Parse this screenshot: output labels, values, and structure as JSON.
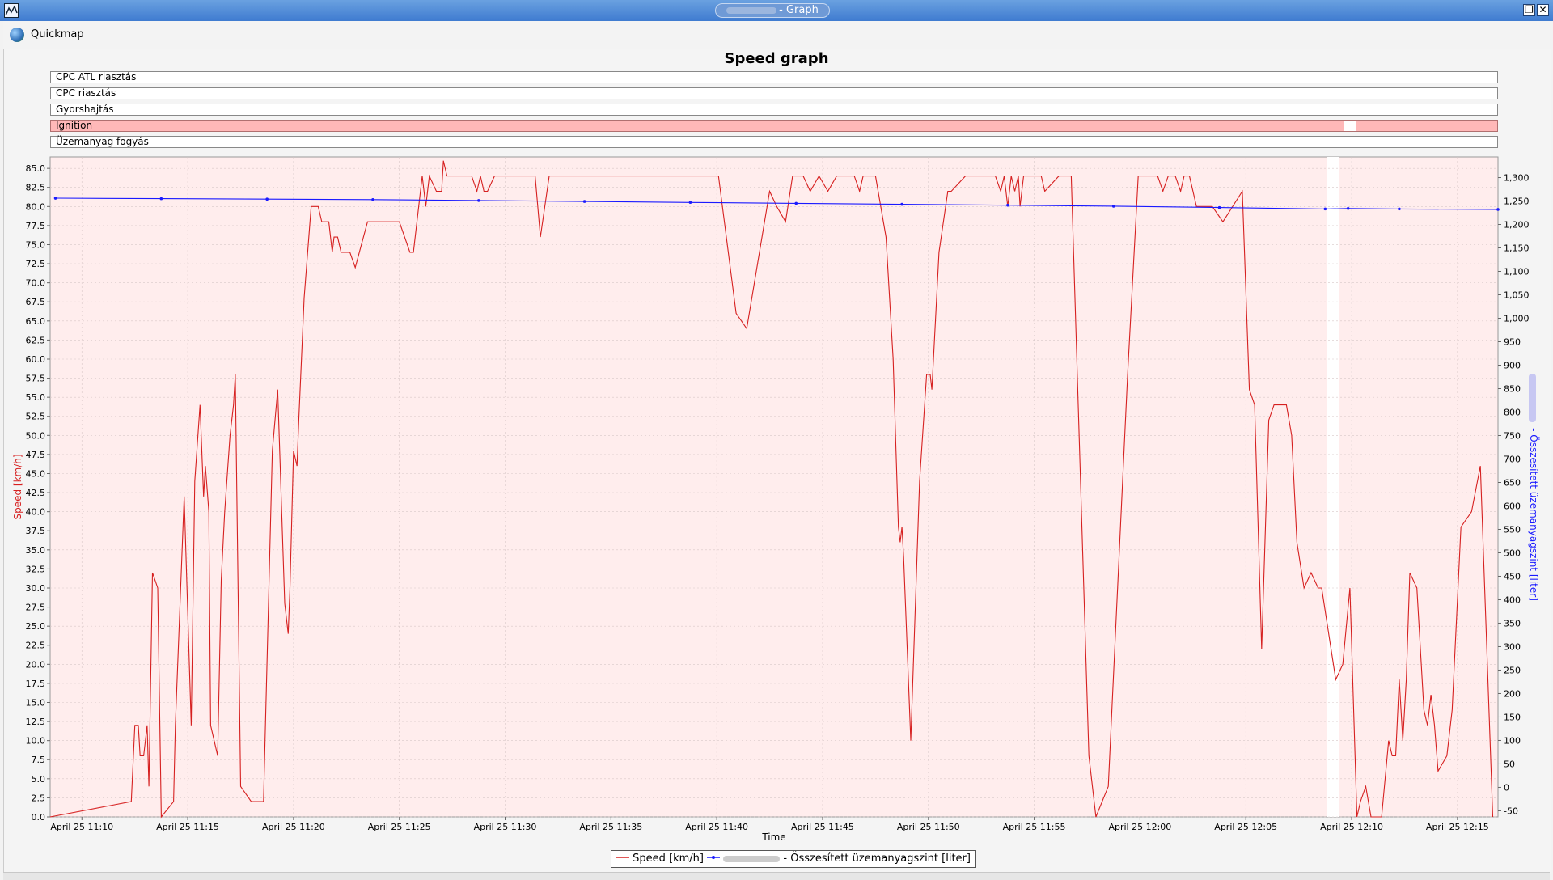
{
  "window": {
    "title": "- Graph"
  },
  "toolbar": {
    "quickmap_label": "Quickmap"
  },
  "chart_title": "Speed graph",
  "event_bands": [
    {
      "label": "CPC ATL riasztás",
      "active": false
    },
    {
      "label": "CPC riasztás",
      "active": false
    },
    {
      "label": "Gyorshajtás",
      "active": false
    },
    {
      "label": "Ignition",
      "active": true
    },
    {
      "label": "Üzemanyag fogyás",
      "active": false
    }
  ],
  "colors": {
    "speed": "#d62020",
    "fuel": "#1a1aff",
    "plot_bg": "#ffeded",
    "ignition_gap": "#ffffff"
  },
  "chart_data": {
    "type": "line",
    "title": "Speed graph",
    "xlabel": "Time",
    "x_ticks": [
      "April 25 11:10",
      "April 25 11:15",
      "April 25 11:20",
      "April 25 11:25",
      "April 25 11:30",
      "April 25 11:35",
      "April 25 11:40",
      "April 25 11:45",
      "April 25 11:50",
      "April 25 11:55",
      "April 25 12:00",
      "April 25 12:05",
      "April 25 12:10",
      "April 25 12:15"
    ],
    "x_start": "11:08:30",
    "x_end": "12:16:55",
    "y_left": {
      "label": "Speed [km/h]",
      "min": 0,
      "max": 86.5,
      "ticks": [
        "0.0",
        "2.5",
        "5.0",
        "7.5",
        "10.0",
        "12.5",
        "15.0",
        "17.5",
        "20.0",
        "22.5",
        "25.0",
        "27.5",
        "30.0",
        "32.5",
        "35.0",
        "37.5",
        "40.0",
        "42.5",
        "45.0",
        "47.5",
        "50.0",
        "52.5",
        "55.0",
        "57.5",
        "60.0",
        "62.5",
        "65.0",
        "67.5",
        "70.0",
        "72.5",
        "75.0",
        "77.5",
        "80.0",
        "82.5",
        "85.0"
      ]
    },
    "y_right": {
      "label": "- Összesített üzemanyagszint [liter]",
      "min": -63,
      "max": 1344,
      "ticks": [
        "-50",
        "0",
        "50",
        "100",
        "150",
        "200",
        "250",
        "300",
        "350",
        "400",
        "450",
        "500",
        "550",
        "600",
        "650",
        "700",
        "750",
        "800",
        "850",
        "900",
        "950",
        "1,000",
        "1,050",
        "1,100",
        "1,150",
        "1,200",
        "1,250",
        "1,300"
      ]
    },
    "ignition_off": {
      "start": "12:08:50",
      "end": "12:09:25"
    },
    "series": [
      {
        "name": "Speed [km/h]",
        "axis": "left",
        "points": [
          [
            "11:08:30",
            0
          ],
          [
            "11:12:20",
            2
          ],
          [
            "11:12:30",
            12
          ],
          [
            "11:12:40",
            12
          ],
          [
            "11:12:45",
            8
          ],
          [
            "11:12:55",
            8
          ],
          [
            "11:13:05",
            12
          ],
          [
            "11:13:10",
            4
          ],
          [
            "11:13:20",
            32
          ],
          [
            "11:13:35",
            30
          ],
          [
            "11:13:45",
            0
          ],
          [
            "11:14:20",
            2
          ],
          [
            "11:14:25",
            12
          ],
          [
            "11:14:50",
            42
          ],
          [
            "11:15:10",
            12
          ],
          [
            "11:15:20",
            44
          ],
          [
            "11:15:35",
            54
          ],
          [
            "11:15:45",
            42
          ],
          [
            "11:15:50",
            46
          ],
          [
            "11:16:00",
            40
          ],
          [
            "11:16:05",
            12
          ],
          [
            "11:16:25",
            8
          ],
          [
            "11:16:35",
            31
          ],
          [
            "11:16:45",
            40
          ],
          [
            "11:17:00",
            50
          ],
          [
            "11:17:10",
            54
          ],
          [
            "11:17:15",
            58
          ],
          [
            "11:17:30",
            4
          ],
          [
            "11:18:00",
            2
          ],
          [
            "11:18:35",
            2
          ],
          [
            "11:19:00",
            48
          ],
          [
            "11:19:15",
            56
          ],
          [
            "11:19:35",
            28
          ],
          [
            "11:19:45",
            24
          ],
          [
            "11:19:50",
            30
          ],
          [
            "11:20:00",
            48
          ],
          [
            "11:20:10",
            46
          ],
          [
            "11:20:15",
            52
          ],
          [
            "11:20:30",
            68
          ],
          [
            "11:20:50",
            80
          ],
          [
            "11:21:10",
            80
          ],
          [
            "11:21:20",
            78
          ],
          [
            "11:21:40",
            78
          ],
          [
            "11:21:50",
            74
          ],
          [
            "11:21:55",
            76
          ],
          [
            "11:22:05",
            76
          ],
          [
            "11:22:15",
            74
          ],
          [
            "11:22:40",
            74
          ],
          [
            "11:22:55",
            72
          ],
          [
            "11:23:30",
            78
          ],
          [
            "11:25:00",
            78
          ],
          [
            "11:25:30",
            74
          ],
          [
            "11:25:40",
            74
          ],
          [
            "11:26:05",
            84
          ],
          [
            "11:26:15",
            80
          ],
          [
            "11:26:25",
            84
          ],
          [
            "11:26:45",
            82
          ],
          [
            "11:27:00",
            82
          ],
          [
            "11:27:05",
            86
          ],
          [
            "11:27:15",
            84
          ],
          [
            "11:28:25",
            84
          ],
          [
            "11:28:40",
            82
          ],
          [
            "11:28:50",
            84
          ],
          [
            "11:29:00",
            82
          ],
          [
            "11:29:10",
            82
          ],
          [
            "11:29:30",
            84
          ],
          [
            "11:31:25",
            84
          ],
          [
            "11:31:40",
            76
          ],
          [
            "11:32:05",
            84
          ],
          [
            "11:36:30",
            84
          ],
          [
            "11:37:05",
            84
          ],
          [
            "11:40:05",
            84
          ],
          [
            "11:40:55",
            66
          ],
          [
            "11:41:25",
            64
          ],
          [
            "11:42:30",
            82
          ],
          [
            "11:42:50",
            80
          ],
          [
            "11:43:15",
            78
          ],
          [
            "11:43:35",
            84
          ],
          [
            "11:44:05",
            84
          ],
          [
            "11:44:25",
            82
          ],
          [
            "11:44:50",
            84
          ],
          [
            "11:45:15",
            82
          ],
          [
            "11:45:40",
            84
          ],
          [
            "11:46:30",
            84
          ],
          [
            "11:46:45",
            82
          ],
          [
            "11:46:55",
            84
          ],
          [
            "11:47:30",
            84
          ],
          [
            "11:48:00",
            76
          ],
          [
            "11:48:20",
            60
          ],
          [
            "11:48:35",
            38
          ],
          [
            "11:48:40",
            36
          ],
          [
            "11:48:45",
            38
          ],
          [
            "11:48:50",
            34
          ],
          [
            "11:49:10",
            10
          ],
          [
            "11:49:35",
            44
          ],
          [
            "11:49:55",
            58
          ],
          [
            "11:50:05",
            58
          ],
          [
            "11:50:10",
            56
          ],
          [
            "11:50:30",
            74
          ],
          [
            "11:50:55",
            82
          ],
          [
            "11:51:05",
            82
          ],
          [
            "11:51:45",
            84
          ],
          [
            "11:53:10",
            84
          ],
          [
            "11:53:25",
            82
          ],
          [
            "11:53:35",
            84
          ],
          [
            "11:53:45",
            80
          ],
          [
            "11:53:55",
            84
          ],
          [
            "11:54:05",
            82
          ],
          [
            "11:54:15",
            84
          ],
          [
            "11:54:20",
            80
          ],
          [
            "11:54:30",
            84
          ],
          [
            "11:55:20",
            84
          ],
          [
            "11:55:30",
            82
          ],
          [
            "11:56:10",
            84
          ],
          [
            "11:56:35",
            84
          ],
          [
            "11:56:45",
            84
          ],
          [
            "11:57:35",
            8
          ],
          [
            "11:57:55",
            0
          ],
          [
            "11:58:30",
            4
          ],
          [
            "11:59:25",
            58
          ],
          [
            "11:59:55",
            84
          ],
          [
            "12:00:50",
            84
          ],
          [
            "12:01:05",
            82
          ],
          [
            "12:01:20",
            84
          ],
          [
            "12:01:40",
            84
          ],
          [
            "12:01:55",
            82
          ],
          [
            "12:02:05",
            84
          ],
          [
            "12:02:20",
            84
          ],
          [
            "12:02:40",
            80
          ],
          [
            "12:03:25",
            80
          ],
          [
            "12:03:55",
            78
          ],
          [
            "12:04:50",
            82
          ],
          [
            "12:05:10",
            56
          ],
          [
            "12:05:25",
            54
          ],
          [
            "12:05:45",
            22
          ],
          [
            "12:06:05",
            52
          ],
          [
            "12:06:20",
            54
          ],
          [
            "12:06:55",
            54
          ],
          [
            "12:07:10",
            50
          ],
          [
            "12:07:25",
            36
          ],
          [
            "12:07:45",
            30
          ],
          [
            "12:08:05",
            32
          ],
          [
            "12:08:25",
            30
          ],
          [
            "12:08:35",
            30
          ],
          [
            "12:09:15",
            18
          ],
          [
            "12:09:35",
            20
          ],
          [
            "12:09:55",
            30
          ],
          [
            "12:10:15",
            0
          ],
          [
            "12:10:25",
            2
          ],
          [
            "12:10:40",
            4
          ],
          [
            "12:10:55",
            0
          ],
          [
            "12:11:25",
            0
          ],
          [
            "12:11:45",
            10
          ],
          [
            "12:11:55",
            8
          ],
          [
            "12:12:05",
            8
          ],
          [
            "12:12:15",
            18
          ],
          [
            "12:12:25",
            10
          ],
          [
            "12:12:35",
            18
          ],
          [
            "12:12:45",
            32
          ],
          [
            "12:13:05",
            30
          ],
          [
            "12:13:25",
            14
          ],
          [
            "12:13:35",
            12
          ],
          [
            "12:13:45",
            16
          ],
          [
            "12:13:55",
            12
          ],
          [
            "12:14:05",
            6
          ],
          [
            "12:14:30",
            8
          ],
          [
            "12:14:45",
            14
          ],
          [
            "12:15:10",
            38
          ],
          [
            "12:15:40",
            40
          ],
          [
            "12:16:05",
            46
          ],
          [
            "12:16:40",
            0
          ]
        ]
      },
      {
        "name": "- Összesített üzemanyagszint [liter]",
        "axis": "right",
        "points": [
          [
            "11:08:45",
            1256
          ],
          [
            "11:13:45",
            1255
          ],
          [
            "11:18:45",
            1254
          ],
          [
            "11:23:45",
            1253
          ],
          [
            "11:28:45",
            1251
          ],
          [
            "11:33:45",
            1249
          ],
          [
            "11:38:45",
            1247
          ],
          [
            "11:43:45",
            1245
          ],
          [
            "11:48:45",
            1243
          ],
          [
            "11:53:45",
            1241
          ],
          [
            "11:58:45",
            1239
          ],
          [
            "12:03:45",
            1236
          ],
          [
            "12:08:45",
            1233
          ],
          [
            "12:09:50",
            1234
          ],
          [
            "12:12:15",
            1233
          ],
          [
            "12:16:55",
            1232
          ]
        ]
      }
    ]
  },
  "legend": {
    "speed": "Speed [km/h]",
    "fuel": "- Összesített üzemanyagszint [liter]"
  }
}
